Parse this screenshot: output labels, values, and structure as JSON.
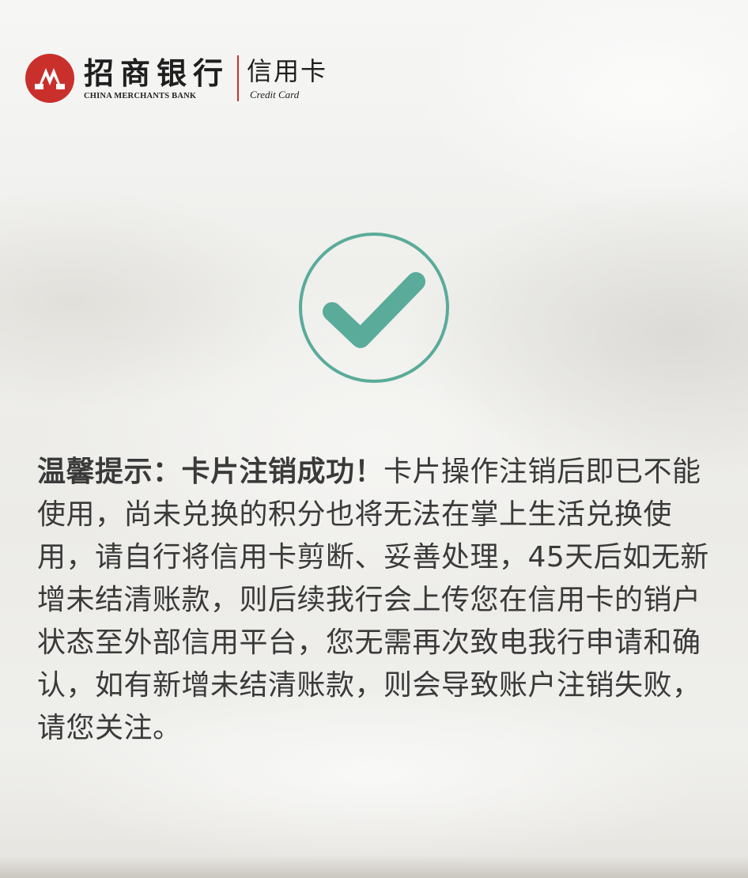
{
  "header": {
    "bank_name_cn": "招商银行",
    "bank_name_en": "CHINA MERCHANTS BANK",
    "product_cn": "信用卡",
    "product_en": "Credit Card",
    "logo_icon": "cmb-logo-icon",
    "brand_color": "#c9302c"
  },
  "status": {
    "icon": "success-check-icon",
    "accent_color": "#5aab9a"
  },
  "notice": {
    "title": "温馨提示：卡片注销成功！",
    "body": "卡片操作注销后即已不能使用，尚未兑换的积分也将无法在掌上生活兑换使用，请自行将信用卡剪断、妥善处理，45天后如无新增未结清账款，则后续我行会上传您在信用卡的销户状态至外部信用平台，您无需再次致电我行申请和确认，如有新增未结清账款，则会导致账户注销失败，请您关注。"
  }
}
